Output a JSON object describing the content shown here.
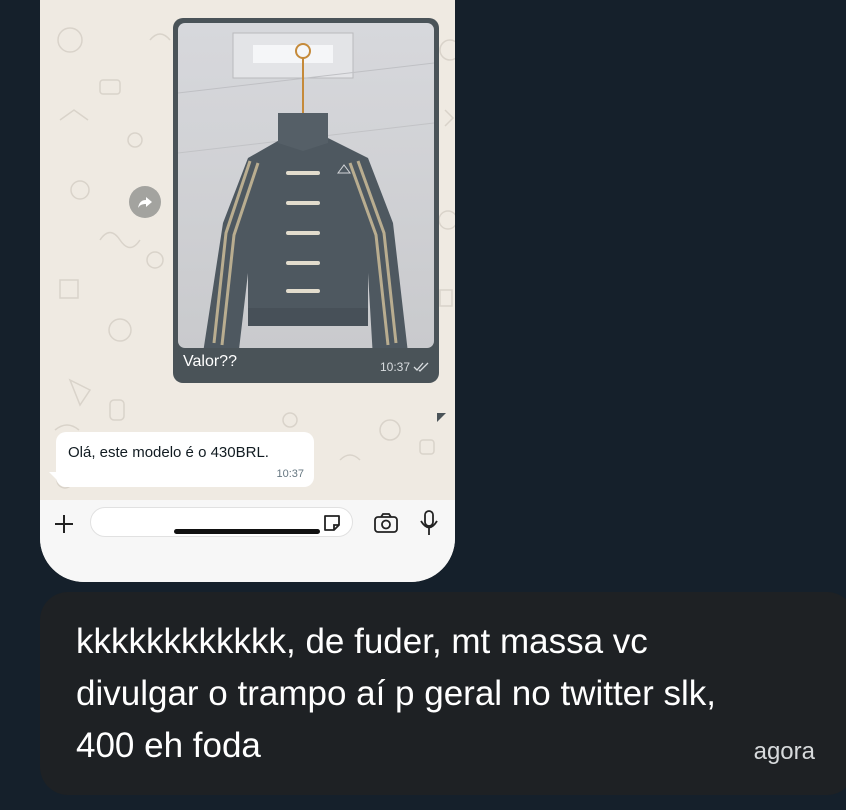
{
  "chat": {
    "image_message": {
      "caption": "Valor??",
      "time": "10:37",
      "status_icon": "double-check-icon",
      "photo_alt": "adidas jacket on hanger"
    },
    "reply_message": {
      "text": "Olá, este modelo é o 430BRL.",
      "time": "10:37"
    }
  },
  "composer": {
    "plus_icon": "plus-icon",
    "placeholder": "",
    "sticker_icon": "sticker-icon",
    "camera_icon": "camera-icon",
    "mic_icon": "mic-icon"
  },
  "outer_message": {
    "text": "kkkkkkkkkkkk, de fuder, mt massa vc divulgar o trampo aí p geral no twitter slk, 400 eh foda",
    "time": "agora"
  },
  "colors": {
    "page_bg": "#15202b",
    "outer_bubble": "#1e2124",
    "chat_bg": "#efeae2",
    "image_bubble": "#4a5358",
    "incoming_bubble": "#ffffff"
  }
}
